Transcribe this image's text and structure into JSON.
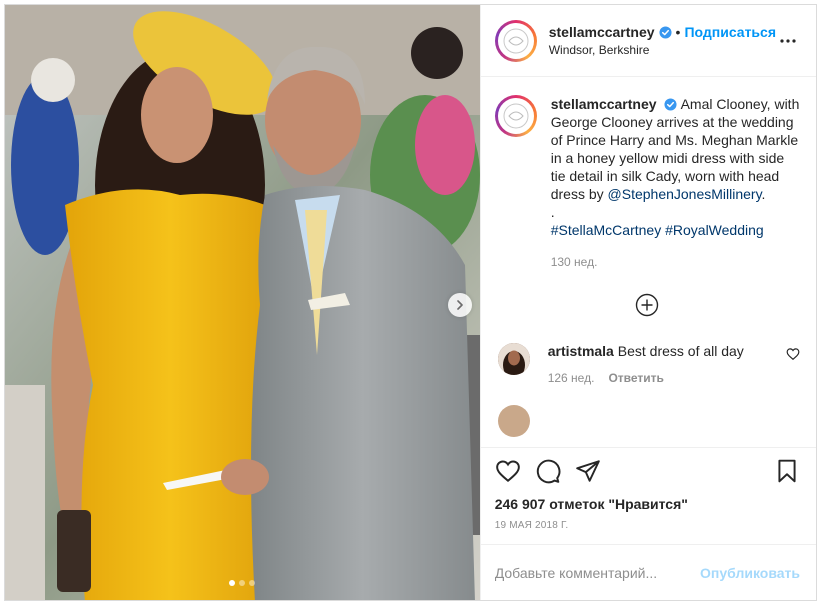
{
  "post": {
    "username": "stellamccartney",
    "follow_label": "Подписаться",
    "follow_separator": "•",
    "location": "Windsor, Berkshire",
    "caption": {
      "author": "stellamccartney",
      "text": "Amal Clooney, with George Clooney arrives at the wedding of Prince Harry and Ms. Meghan Markle in a honey yellow midi dress with side tie detail in silk Cady, worn with head dress by",
      "mention": "@StephenJonesMillinery",
      "after_mention": ".",
      "dot_line": ".",
      "hashtag_1": "#StellaMcCartney",
      "hashtag_2": "#RoyalWedding",
      "time": "130 нед."
    },
    "comments": [
      {
        "author": "artistmala",
        "text": "Best dress of all day",
        "time": "126 нед.",
        "reply_label": "Ответить"
      }
    ],
    "likes": "246 907 отметок \"Нравится\"",
    "date": "19 МАЯ 2018 Г.",
    "add_comment_placeholder": "Добавьте комментарий...",
    "publish_label": "Опубликовать",
    "carousel": {
      "slides": 3,
      "active": 1
    }
  },
  "colors": {
    "accent": "#0095f6",
    "dress": "#f2b90f",
    "suit": "#9ea2a4"
  },
  "icons": [
    "verified-icon",
    "more-options-icon",
    "add-icon",
    "heart-icon",
    "comment-icon",
    "share-icon",
    "bookmark-icon",
    "chevron-right-icon"
  ]
}
